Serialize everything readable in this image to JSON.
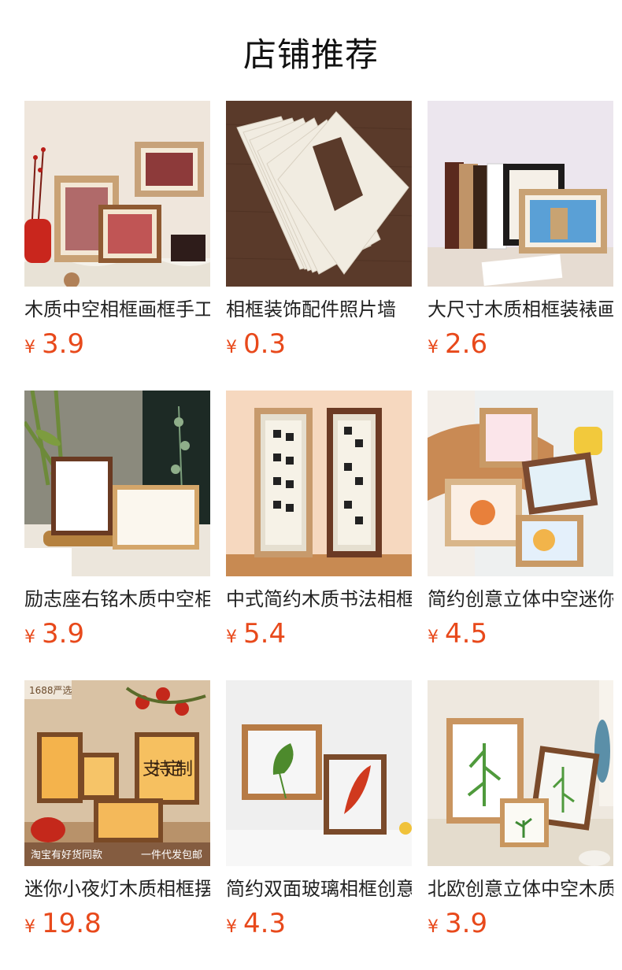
{
  "header": {
    "title": "店铺推荐"
  },
  "products": [
    {
      "title": "木质中空相框画框手工",
      "currency": "¥",
      "price": "3.9"
    },
    {
      "title": "相框装饰配件照片墙",
      "currency": "¥",
      "price": "0.3"
    },
    {
      "title": "大尺寸木质相框装裱画",
      "currency": "¥",
      "price": "2.6"
    },
    {
      "title": "励志座右铭木质中空相",
      "currency": "¥",
      "price": "3.9"
    },
    {
      "title": "中式简约木质书法相框",
      "currency": "¥",
      "price": "5.4"
    },
    {
      "title": "简约创意立体中空迷你",
      "currency": "¥",
      "price": "4.5"
    },
    {
      "title": "迷你小夜灯木质相框摆",
      "currency": "¥",
      "price": "19.8"
    },
    {
      "title": "简约双面玻璃相框创意",
      "currency": "¥",
      "price": "4.3"
    },
    {
      "title": "北欧创意立体中空木质",
      "currency": "¥",
      "price": "3.9"
    }
  ],
  "image_text": {
    "badge_top": "1688严选",
    "banner_left": "淘宝有好货同款",
    "banner_right": "一件代发包邮",
    "sign": "支持定制"
  },
  "colors": {
    "price": "#e8491b",
    "title": "#222222"
  }
}
